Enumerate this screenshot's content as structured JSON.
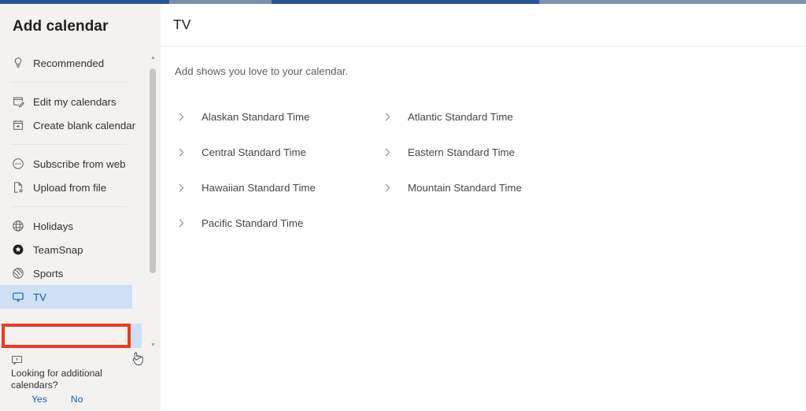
{
  "window": {
    "chrome_color_primary": "#2a5699",
    "chrome_color_secondary": "#7b91ac"
  },
  "sidebar": {
    "title": "Add calendar",
    "groups": [
      {
        "items": [
          {
            "label": "Recommended",
            "icon": "lightbulb-icon",
            "selected": false
          }
        ]
      },
      {
        "items": [
          {
            "label": "Edit my calendars",
            "icon": "edit-calendar-icon",
            "selected": false
          },
          {
            "label": "Create blank calendar",
            "icon": "add-calendar-icon",
            "selected": false
          }
        ]
      },
      {
        "items": [
          {
            "label": "Subscribe from web",
            "icon": "subscribe-icon",
            "selected": false
          },
          {
            "label": "Upload from file",
            "icon": "upload-file-icon",
            "selected": false
          }
        ]
      },
      {
        "items": [
          {
            "label": "Holidays",
            "icon": "globe-icon",
            "selected": false
          },
          {
            "label": "TeamSnap",
            "icon": "teamsnap-icon",
            "selected": false
          },
          {
            "label": "Sports",
            "icon": "sports-ball-icon",
            "selected": false
          },
          {
            "label": "TV",
            "icon": "monitor-icon",
            "selected": true
          }
        ]
      }
    ],
    "footer": {
      "prompt": "Looking for additional calendars?",
      "yes_label": "Yes",
      "no_label": "No",
      "icon": "feedback-icon"
    },
    "scrollbar": {
      "up_arrow": "▲",
      "down_arrow": "▼"
    },
    "selected_item_bg": "#cfe0f5",
    "selected_item_text": "#0f5ba7",
    "annotation_color": "#ee3b1e"
  },
  "main": {
    "title": "TV",
    "subtitle": "Add shows you love to your calendar.",
    "timezones": [
      "Alaskan Standard Time",
      "Atlantic Standard Time",
      "Central Standard Time",
      "Eastern Standard Time",
      "Hawaiian Standard Time",
      "Mountain Standard Time",
      "Pacific Standard Time"
    ]
  }
}
